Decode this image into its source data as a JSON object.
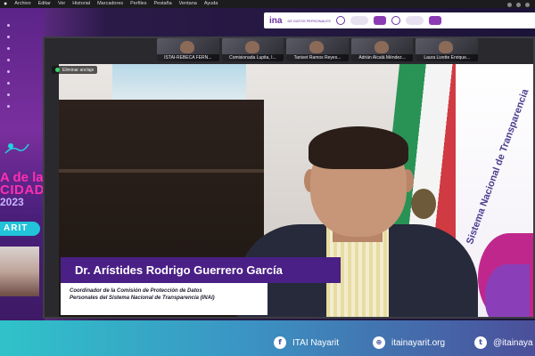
{
  "menubar": {
    "items": [
      "Archivo",
      "Editar",
      "Ver",
      "Historial",
      "Marcadores",
      "Perfiles",
      "Pestaña",
      "Ventana",
      "Ayuda"
    ]
  },
  "left_banner": {
    "line1": "A de la",
    "line2": "CIDAD",
    "year": "2023",
    "arit": "ARIT"
  },
  "header": {
    "small_text": "DE DATOS PERSONALES"
  },
  "participants": [
    {
      "name": "ISTAI-REBECA FERN..."
    },
    {
      "name": "Comisionada Lupita, I..."
    },
    {
      "name": "Tanivet Ramos Reyes..."
    },
    {
      "name": "Adrián Alcalá Méndez..."
    },
    {
      "name": "Laura Lizette Enrique..."
    }
  ],
  "video": {
    "unpin_label": "Eliminar anclaje",
    "speaker_name": "Dr. Arístides Rodrigo Guerrero García",
    "speaker_title": "Coordinador de la Comisión de Protección de Datos\nPersonales del Sistema Nacional de Transparencia (INAI)",
    "banner_text": "Sistema Nacional de Transparencia"
  },
  "social": {
    "facebook": "ITAI Nayarit",
    "website": "itainayarit.org",
    "twitter": "@itainaya"
  },
  "colors": {
    "accent_purple": "#4a1f86",
    "pink": "#ff2fb0",
    "cyan": "#21c4d8"
  }
}
